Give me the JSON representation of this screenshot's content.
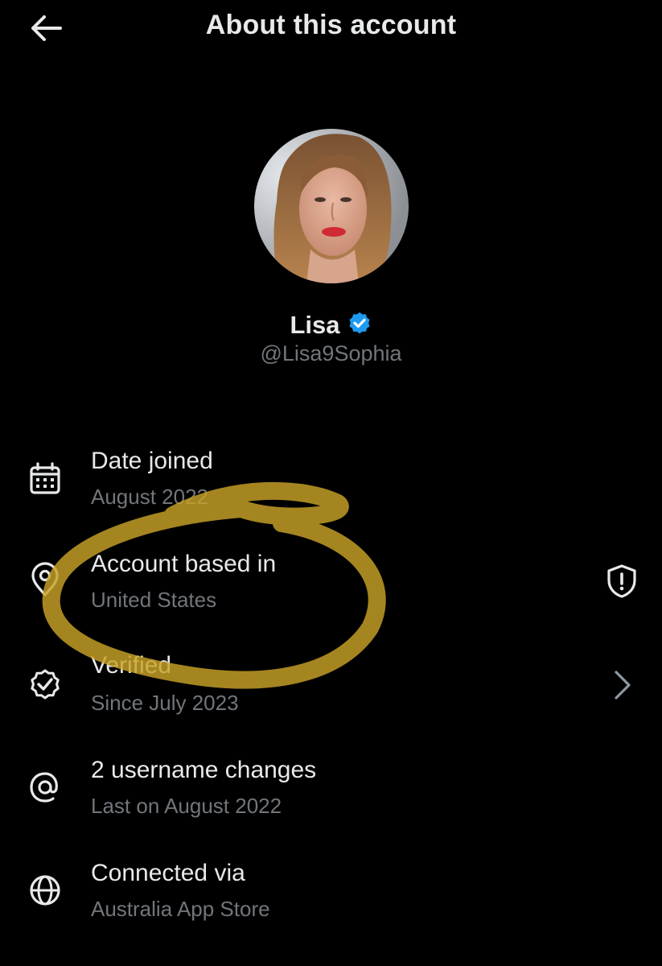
{
  "header": {
    "title": "About this account",
    "back_icon": "arrow-left-icon"
  },
  "profile": {
    "display_name": "Lisa",
    "handle": "@Lisa9Sophia",
    "verified_badge_color": "#1d9bf0"
  },
  "details": [
    {
      "icon": "calendar-icon",
      "label": "Date joined",
      "value": "August 2022"
    },
    {
      "icon": "location-pin-icon",
      "label": "Account based in",
      "value": "United States",
      "right_icon": "shield-alert-icon"
    },
    {
      "icon": "verified-check-icon",
      "label": "Verified",
      "value": "Since July 2023",
      "right_icon": "chevron-right-icon"
    },
    {
      "icon": "at-sign-icon",
      "label": "2 username changes",
      "value": "Last on August 2022"
    },
    {
      "icon": "globe-icon",
      "label": "Connected via",
      "value": "Australia App Store"
    }
  ],
  "colors": {
    "background": "#000000",
    "primary_text": "#e7e9ea",
    "secondary_text": "#71767b",
    "annotation": "#c9a227"
  }
}
